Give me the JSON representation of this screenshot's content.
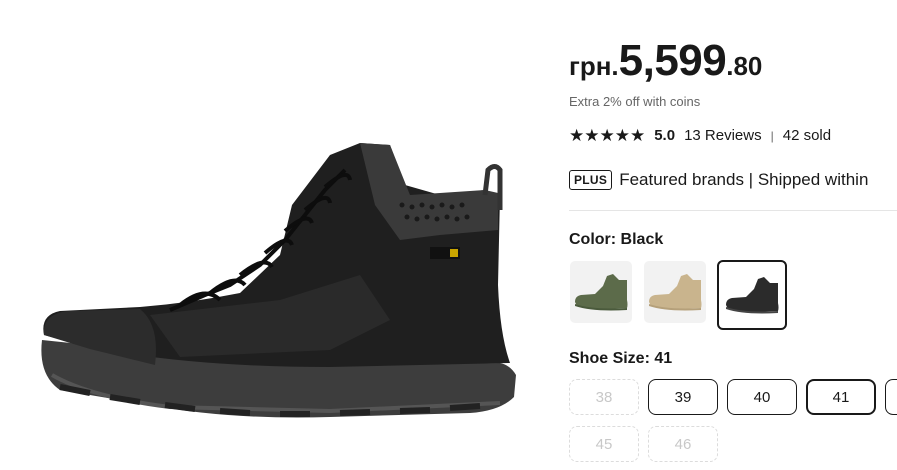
{
  "product": {
    "image_icon": "hiking-boot-black"
  },
  "price": {
    "currency": "грн.",
    "integer": "5,599",
    "decimal": ".80"
  },
  "coins_note": "Extra 2% off with coins",
  "rating": {
    "stars": "★★★★★",
    "score": "5.0",
    "reviews": "13 Reviews",
    "separator": "|",
    "sold": "42 sold"
  },
  "plus": {
    "badge": "PLUS",
    "text": "Featured brands | Shipped within"
  },
  "color": {
    "label": "Color: Black",
    "options": [
      {
        "icon": "boot-green-thumbnail",
        "selected": false
      },
      {
        "icon": "boot-tan-thumbnail",
        "selected": false
      },
      {
        "icon": "boot-black-thumbnail",
        "selected": true
      }
    ]
  },
  "size": {
    "label": "Shoe Size: 41",
    "options": [
      {
        "value": "38",
        "disabled": true
      },
      {
        "value": "39",
        "disabled": false
      },
      {
        "value": "40",
        "disabled": false
      },
      {
        "value": "41",
        "selected": true
      },
      {
        "value": "",
        "disabled": false
      },
      {
        "value": "45",
        "disabled": true
      },
      {
        "value": "46",
        "disabled": true
      }
    ]
  },
  "colors": {
    "text": "#191919",
    "muted": "#666666",
    "boot_black": "#2b2b2b",
    "boot_green": "#5c6b4a",
    "boot_tan": "#c9b48d"
  }
}
